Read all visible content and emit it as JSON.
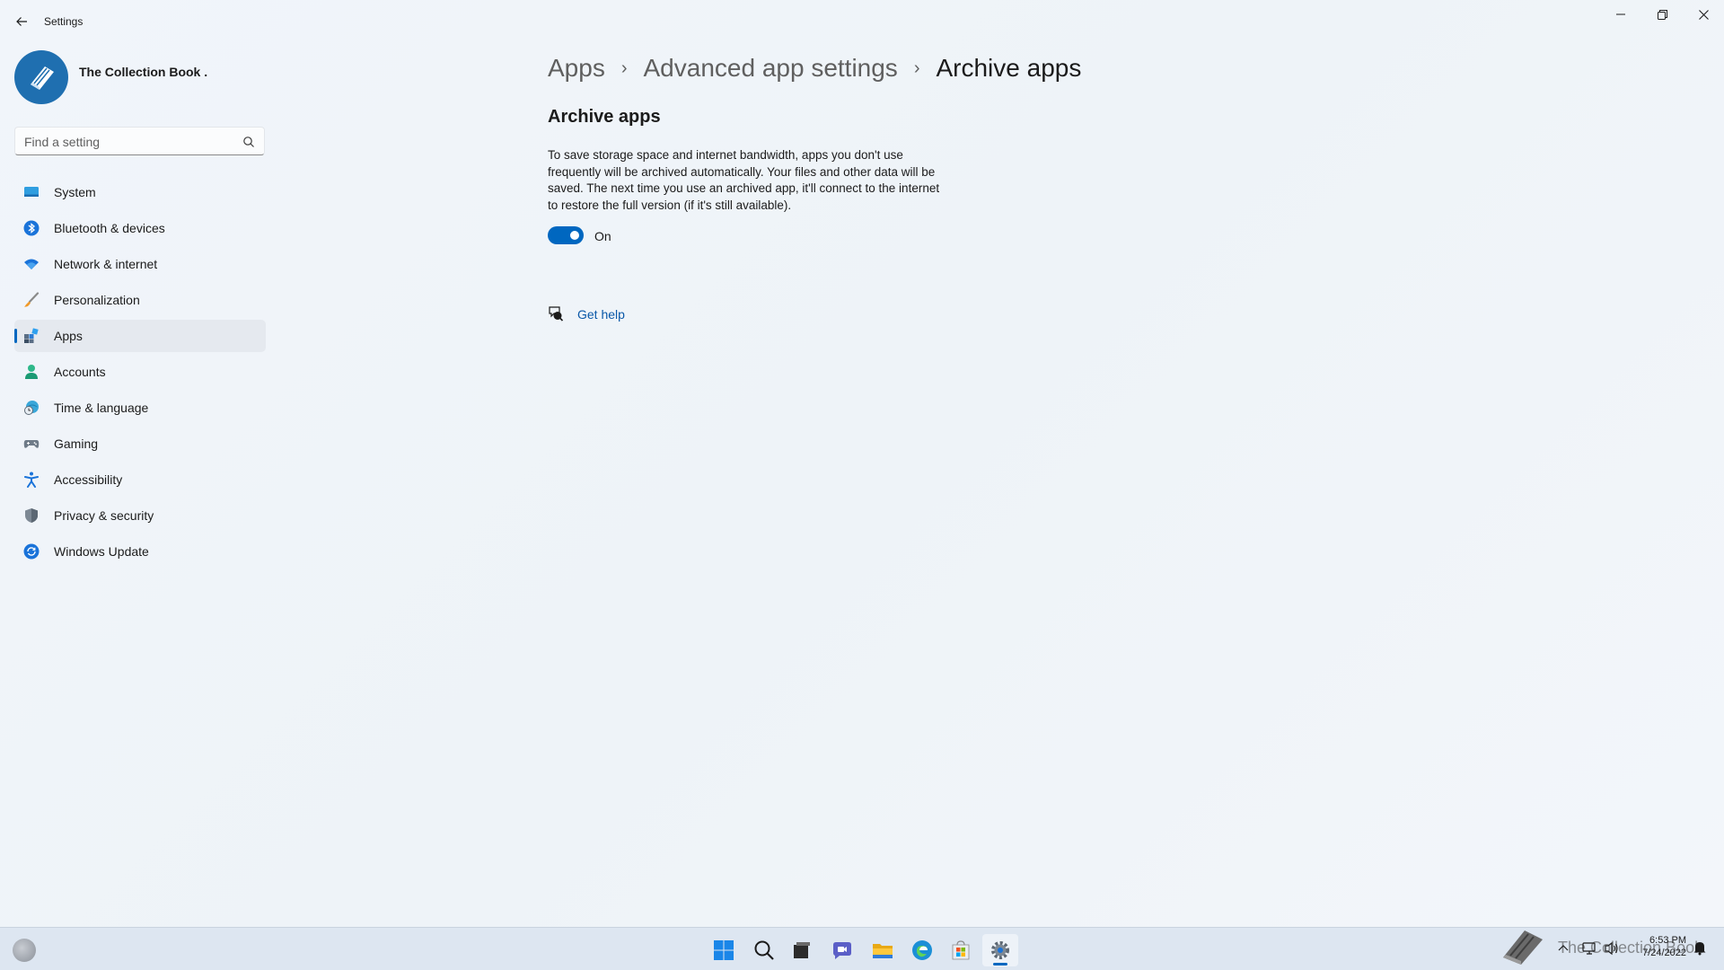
{
  "window": {
    "title": "Settings"
  },
  "profile": {
    "name": "The Collection Book ."
  },
  "search": {
    "placeholder": "Find a setting"
  },
  "nav": {
    "items": [
      {
        "label": "System",
        "icon": "monitor-icon"
      },
      {
        "label": "Bluetooth & devices",
        "icon": "bluetooth-icon"
      },
      {
        "label": "Network & internet",
        "icon": "wifi-icon"
      },
      {
        "label": "Personalization",
        "icon": "brush-icon"
      },
      {
        "label": "Apps",
        "icon": "apps-icon",
        "active": true
      },
      {
        "label": "Accounts",
        "icon": "person-icon"
      },
      {
        "label": "Time & language",
        "icon": "globe-clock-icon"
      },
      {
        "label": "Gaming",
        "icon": "gamepad-icon"
      },
      {
        "label": "Accessibility",
        "icon": "accessibility-icon"
      },
      {
        "label": "Privacy & security",
        "icon": "shield-icon"
      },
      {
        "label": "Windows Update",
        "icon": "update-icon"
      }
    ]
  },
  "breadcrumb": [
    "Apps",
    "Advanced app settings",
    "Archive apps"
  ],
  "main": {
    "section_title": "Archive apps",
    "description": "To save storage space and internet bandwidth, apps you don't use frequently will be archived automatically. Your files and other data will be saved. The next time you use an archived app, it'll connect to the internet to restore the full version (if it's still available).",
    "toggle": {
      "state": true,
      "label": "On"
    },
    "help_label": "Get help"
  },
  "taskbar": {
    "apps": [
      "start-icon",
      "search-icon",
      "task-view-icon",
      "chat-icon",
      "file-explorer-icon",
      "edge-icon",
      "store-icon",
      "settings-icon"
    ],
    "active_app": "settings-icon",
    "watermark_text": "The Collection Book",
    "time": "6:53 PM",
    "date": "7/24/2022"
  },
  "colors": {
    "accent": "#0067c0",
    "background": "#eff4f9",
    "link": "#0a58a8"
  }
}
